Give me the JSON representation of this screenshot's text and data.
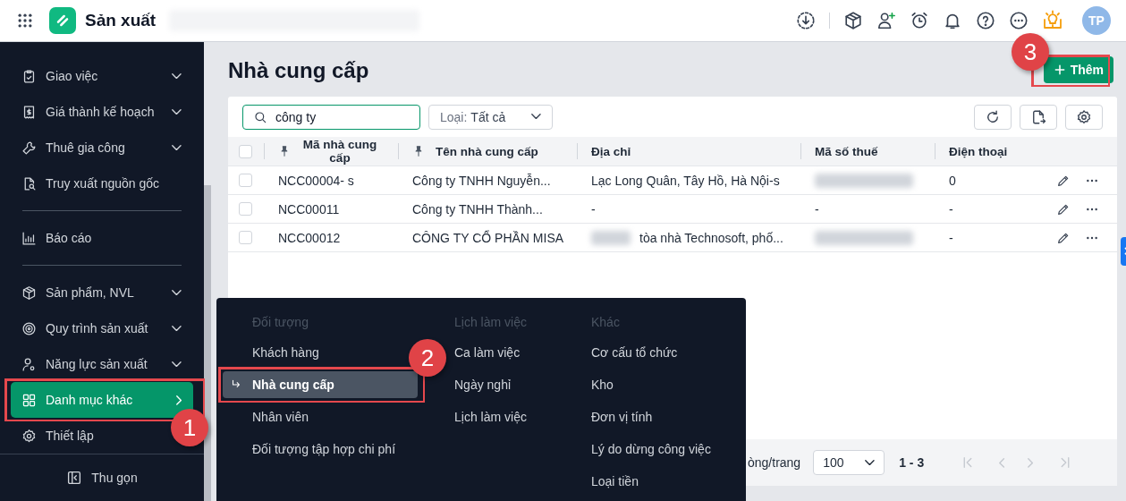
{
  "app": {
    "title": "Sản xuất",
    "avatar": "TP"
  },
  "sidebar": {
    "items": [
      {
        "kind": "item",
        "label": "Giao việc",
        "expandable": true,
        "selected": false
      },
      {
        "kind": "item",
        "label": "Giá thành kế hoạch",
        "expandable": true,
        "selected": false
      },
      {
        "kind": "item",
        "label": "Thuê gia công",
        "expandable": true,
        "selected": false
      },
      {
        "kind": "item",
        "label": "Truy xuất nguồn gốc",
        "expandable": false,
        "selected": false
      },
      {
        "kind": "divider"
      },
      {
        "kind": "item",
        "label": "Báo cáo",
        "expandable": false,
        "selected": false
      },
      {
        "kind": "divider"
      },
      {
        "kind": "item",
        "label": "Sản phẩm, NVL",
        "expandable": true,
        "selected": false
      },
      {
        "kind": "item",
        "label": "Quy trình sản xuất",
        "expandable": true,
        "selected": false
      },
      {
        "kind": "item",
        "label": "Năng lực sản xuất",
        "expandable": true,
        "selected": false
      },
      {
        "kind": "item",
        "label": "Danh mục khác",
        "expandable": false,
        "selected": true
      },
      {
        "kind": "item",
        "label": "Thiết lập",
        "expandable": false,
        "selected": false
      }
    ],
    "collapse": "Thu gọn"
  },
  "page": {
    "title": "Nhà cung cấp",
    "add_button": "Thêm",
    "search": {
      "value": "công ty"
    },
    "filter": {
      "label": "Loại:",
      "value": "Tất cả"
    },
    "table": {
      "select_all": {
        "checked": false
      },
      "columns": [
        {
          "label": "Mã nhà cung cấp",
          "pinned": true
        },
        {
          "label": "Tên nhà cung cấp",
          "pinned": true
        },
        {
          "label": "Địa chỉ",
          "pinned": false
        },
        {
          "label": "Mã số thuế",
          "pinned": false
        },
        {
          "label": "Điện thoại",
          "pinned": false
        }
      ],
      "rows": [
        {
          "checked": false,
          "code": "NCC00004- s",
          "name": "Công ty TNHH Nguyễn...",
          "address": {
            "text": "Lạc Long Quân, Tây Hồ, Hà Nội-s",
            "blurred_prefix": false
          },
          "tax_code": {
            "blurred": true
          },
          "phone": "0"
        },
        {
          "checked": false,
          "code": "NCC00011",
          "name": "Công ty TNHH Thành...",
          "address": {
            "text": "-",
            "blurred_prefix": false
          },
          "tax_code": {
            "blurred": false,
            "text": "-"
          },
          "phone": "-"
        },
        {
          "checked": false,
          "code": "NCC00012",
          "name": "CÔNG TY CỔ PHẦN MISA",
          "address": {
            "text": "tòa nhà Technosoft, phố...",
            "blurred_prefix": true
          },
          "tax_code": {
            "blurred": true
          },
          "phone": "-"
        }
      ]
    },
    "pagination": {
      "rows_label": "òng/trang",
      "page_size": "100",
      "range": "1 - 3"
    }
  },
  "menu": {
    "columns": [
      {
        "header": "Đối tượng",
        "items": [
          {
            "label": "Khách hàng",
            "selected": false
          },
          {
            "label": "Nhà cung cấp",
            "selected": true
          },
          {
            "label": "Nhân viên",
            "selected": false
          },
          {
            "label": "Đối tượng tập hợp chi phí",
            "selected": false
          }
        ]
      },
      {
        "header": "Lịch làm việc",
        "items": [
          {
            "label": "Ca làm việc",
            "selected": false
          },
          {
            "label": "Ngày nghỉ",
            "selected": false
          },
          {
            "label": "Lịch làm việc",
            "selected": false
          }
        ]
      },
      {
        "header": "Khác",
        "items": [
          {
            "label": "Cơ cấu tổ chức",
            "selected": false
          },
          {
            "label": "Kho",
            "selected": false
          },
          {
            "label": "Đơn vị tính",
            "selected": false
          },
          {
            "label": "Lý do dừng công việc",
            "selected": false
          },
          {
            "label": "Loại tiền",
            "selected": false
          }
        ]
      }
    ]
  },
  "callouts": [
    {
      "label": "1"
    },
    {
      "label": "2"
    },
    {
      "label": "3"
    }
  ]
}
